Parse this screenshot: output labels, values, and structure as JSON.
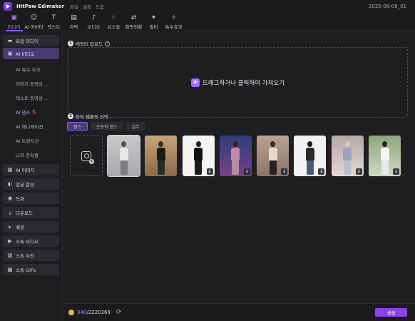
{
  "app": {
    "name": "HitPaw Edimakor",
    "menu": [
      "파일",
      "설정",
      "도움"
    ],
    "date": "2025-08-08_01"
  },
  "toolbar": {
    "tools": [
      {
        "label": "미디어",
        "icon": "media-icon",
        "active": true
      },
      {
        "label": "AI 아바타",
        "icon": "avatar-icon",
        "active": false
      },
      {
        "label": "텍스트",
        "icon": "text-icon",
        "active": false
      },
      {
        "label": "자막",
        "icon": "subtitle-icon",
        "active": false
      },
      {
        "label": "오디오",
        "icon": "audio-icon",
        "active": false
      },
      {
        "label": "요소들",
        "icon": "elements-icon",
        "active": false
      },
      {
        "label": "화면전환",
        "icon": "transition-icon",
        "active": false
      },
      {
        "label": "필터",
        "icon": "filter-icon",
        "active": false
      },
      {
        "label": "특수효과",
        "icon": "effects-icon",
        "active": false
      }
    ]
  },
  "sidebar": {
    "local_media": "로컬 미디어",
    "ai_video": "AI 비디오",
    "sub_items": [
      "AI 특수 효과",
      "이미지 동영상 ...",
      "텍스트 동영상 ...",
      "AI 댄스",
      "AI 애니메이션",
      "AI 트랜지션",
      "나의 창작물"
    ],
    "active_sub": "AI 댄스",
    "items": [
      "AI 이미지",
      "얼굴 합성",
      "녹화",
      "다운로드",
      "배경",
      "스톡 비디오",
      "스톡 사진",
      "스톡 GIFs"
    ]
  },
  "main": {
    "step1": {
      "num": "1",
      "title": "캐릭터 업로드"
    },
    "dropzone_text": "드래그하거나 클릭하여 가져오기",
    "step2": {
      "num": "2",
      "title": "동작 템플릿 선택"
    },
    "tabs": [
      "댄스",
      "손동작 댄스",
      "걸무"
    ],
    "active_tab": "댄스"
  },
  "bottom": {
    "credits_used": "340",
    "credits_total": "/2220369",
    "generate_label": "생성"
  }
}
